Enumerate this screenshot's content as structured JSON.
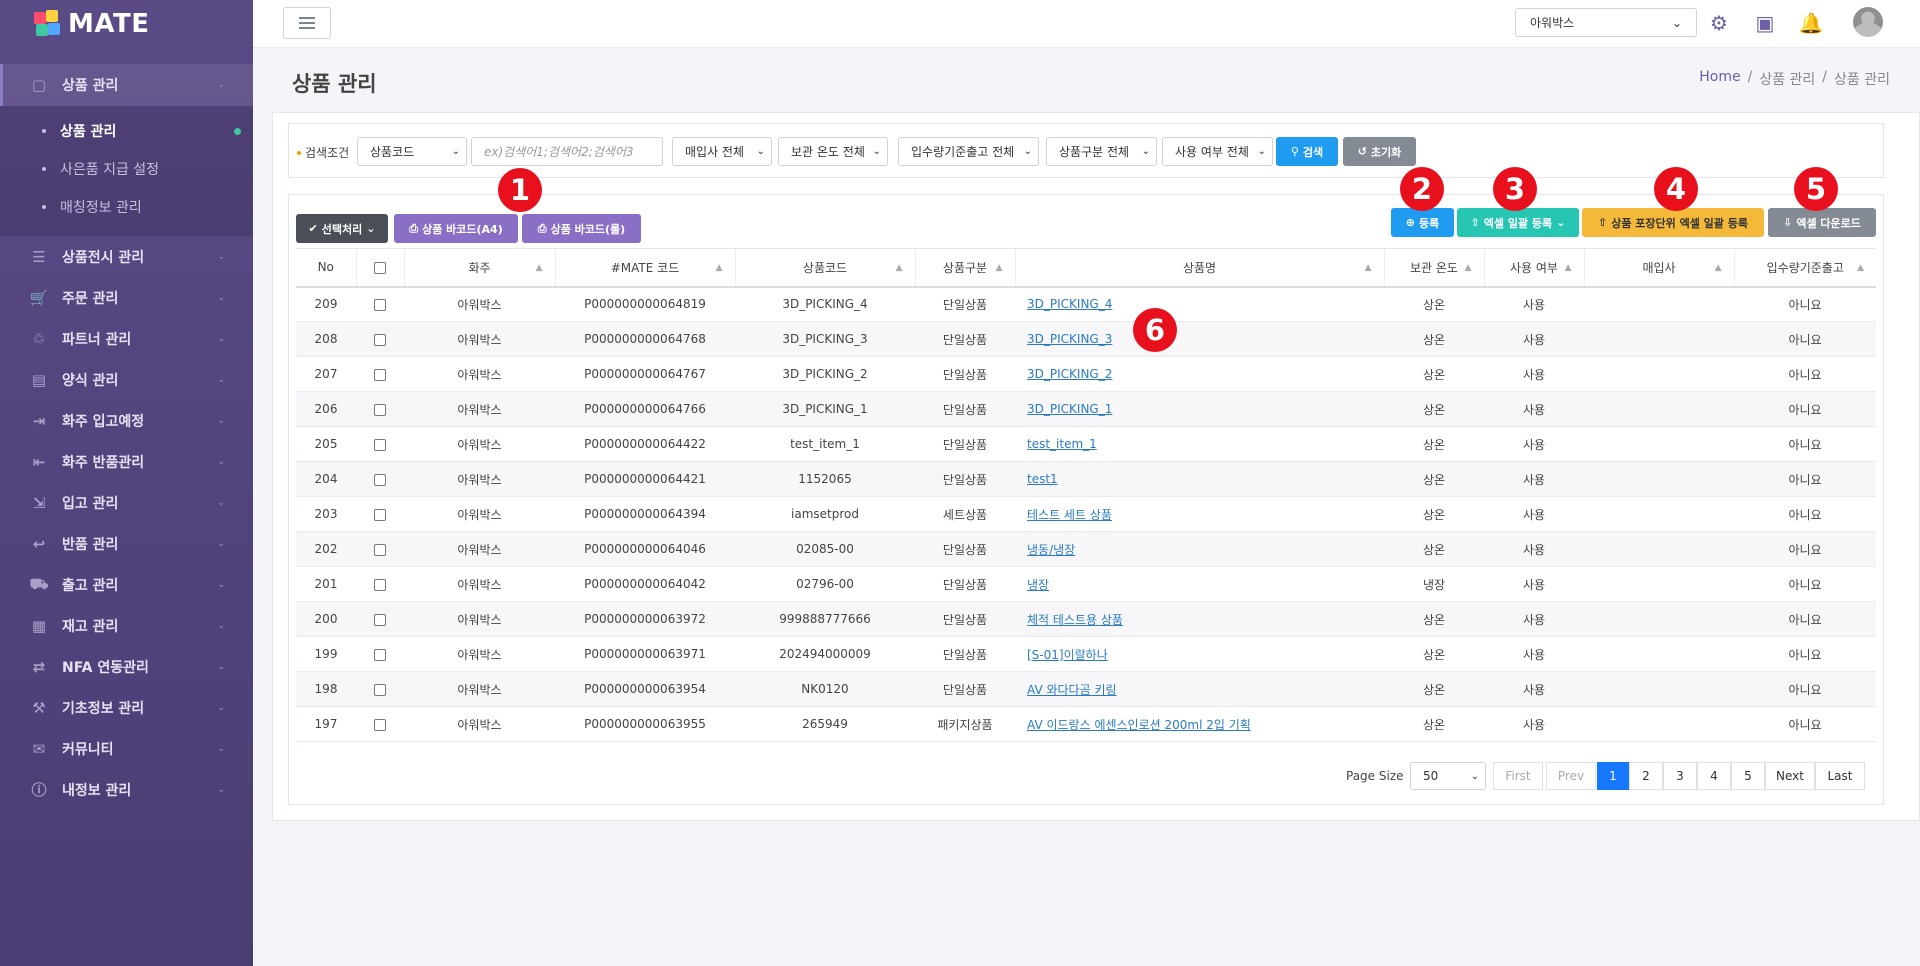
{
  "app": {
    "logo": "MATE"
  },
  "sidebar": {
    "items": [
      {
        "label": "상품 관리",
        "icon": "box-icon",
        "glyph": "▢",
        "active": true
      },
      {
        "label": "상품전시 관리",
        "icon": "display-icon",
        "glyph": "☰"
      },
      {
        "label": "주문 관리",
        "icon": "cart-icon",
        "glyph": "🛒"
      },
      {
        "label": "파트너 관리",
        "icon": "handshake-icon",
        "glyph": "♲"
      },
      {
        "label": "양식 관리",
        "icon": "document-icon",
        "glyph": "▤"
      },
      {
        "label": "화주 입고예정",
        "icon": "truck-in-icon",
        "glyph": "⇥"
      },
      {
        "label": "화주 반품관리",
        "icon": "return-icon",
        "glyph": "⇤"
      },
      {
        "label": "입고 관리",
        "icon": "inbound-icon",
        "glyph": "⇲"
      },
      {
        "label": "반품 관리",
        "icon": "return-box-icon",
        "glyph": "↩"
      },
      {
        "label": "출고 관리",
        "icon": "truck-icon",
        "glyph": "⛟"
      },
      {
        "label": "재고 관리",
        "icon": "stock-icon",
        "glyph": "▦"
      },
      {
        "label": "NFA 연동관리",
        "icon": "link-icon",
        "glyph": "⇄"
      },
      {
        "label": "기초정보 관리",
        "icon": "wrench-icon",
        "glyph": "⚒"
      },
      {
        "label": "커뮤니티",
        "icon": "chat-icon",
        "glyph": "✉"
      },
      {
        "label": "내정보 관리",
        "icon": "info-icon",
        "glyph": "ⓘ"
      }
    ],
    "subitems": [
      {
        "label": "상품 관리",
        "active": true
      },
      {
        "label": "사은품 지급 설정"
      },
      {
        "label": "매칭정보 관리"
      }
    ]
  },
  "topbar": {
    "company": "아워박스"
  },
  "page": {
    "title": "상품 관리"
  },
  "breadcrumb": [
    "Home",
    "/",
    "상품 관리",
    "/",
    "상품 관리"
  ],
  "search": {
    "label": "검색조건",
    "field_select": "상품코드",
    "placeholder": "ex)검색어1;검색어2;검색어3",
    "filters": [
      "매입사 전체",
      "보관 온도 전체",
      "입수량기준출고 전체",
      "상품구분 전체",
      "사용 여부 전체"
    ],
    "search_btn": "검색",
    "reset_btn": "초기화"
  },
  "toolbar": {
    "select_action": "선택처리",
    "barcode_a4": "상품 바코드(A4)",
    "barcode_roll": "상품 바코드(롤)",
    "register": "등록",
    "excel_bulk": "엑셀 일괄 등록",
    "pack_excel_bulk": "상품 포장단위 엑셀 일괄 등록",
    "excel_download": "엑셀 다운로드"
  },
  "colors": {
    "purple_btn": "#8a6fc6",
    "blue_btn": "#1f9bf0",
    "teal_btn": "#26c6b3",
    "yellow_btn": "#f5b93a",
    "gray_btn": "#858b94",
    "dark_btn": "#4a4f57",
    "marker": "#e8101c"
  },
  "table": {
    "headers": [
      "No",
      "",
      "화주",
      "#MATE 코드",
      "상품코드",
      "상품구분",
      "상품명",
      "보관 온도",
      "사용 여부",
      "매입사",
      "입수량기준출고"
    ],
    "rows": [
      [
        "209",
        "아워박스",
        "P000000000064819",
        "3D_PICKING_4",
        "단일상품",
        "3D_PICKING_4",
        "상온",
        "사용",
        "",
        "아니요"
      ],
      [
        "208",
        "아워박스",
        "P000000000064768",
        "3D_PICKING_3",
        "단일상품",
        "3D_PICKING_3",
        "상온",
        "사용",
        "",
        "아니요"
      ],
      [
        "207",
        "아워박스",
        "P000000000064767",
        "3D_PICKING_2",
        "단일상품",
        "3D_PICKING_2",
        "상온",
        "사용",
        "",
        "아니요"
      ],
      [
        "206",
        "아워박스",
        "P000000000064766",
        "3D_PICKING_1",
        "단일상품",
        "3D_PICKING_1",
        "상온",
        "사용",
        "",
        "아니요"
      ],
      [
        "205",
        "아워박스",
        "P000000000064422",
        "test_item_1",
        "단일상품",
        "test_item_1",
        "상온",
        "사용",
        "",
        "아니요"
      ],
      [
        "204",
        "아워박스",
        "P000000000064421",
        "1152065",
        "단일상품",
        "test1",
        "상온",
        "사용",
        "",
        "아니요"
      ],
      [
        "203",
        "아워박스",
        "P000000000064394",
        "iamsetprod",
        "세트상품",
        "테스트 세트 상품",
        "상온",
        "사용",
        "",
        "아니요"
      ],
      [
        "202",
        "아워박스",
        "P000000000064046",
        "02085-00",
        "단일상품",
        "냉동/냉장",
        "상온",
        "사용",
        "",
        "아니요"
      ],
      [
        "201",
        "아워박스",
        "P000000000064042",
        "02796-00",
        "단일상품",
        "냉장",
        "냉장",
        "사용",
        "",
        "아니요"
      ],
      [
        "200",
        "아워박스",
        "P000000000063972",
        "999888777666",
        "단일상품",
        "체적 테스트용 상품",
        "상온",
        "사용",
        "",
        "아니요"
      ],
      [
        "199",
        "아워박스",
        "P000000000063971",
        "202494000009",
        "단일상품",
        "[S-01]이랄하나",
        "상온",
        "사용",
        "",
        "아니요"
      ],
      [
        "198",
        "아워박스",
        "P000000000063954",
        "NK0120",
        "단일상품",
        "AV 와다다곰 키링",
        "상온",
        "사용",
        "",
        "아니요"
      ],
      [
        "197",
        "아워박스",
        "P000000000063955",
        "265949",
        "패키지상품",
        "AV 이드랑스 에센스인로션 200ml 2입 기획",
        "상온",
        "사용",
        "",
        "아니요"
      ]
    ]
  },
  "pagination": {
    "page_size_label": "Page Size",
    "page_size": "50",
    "first": "First",
    "prev": "Prev",
    "pages": [
      "1",
      "2",
      "3",
      "4",
      "5"
    ],
    "current": "1",
    "next": "Next",
    "last": "Last"
  },
  "markers": [
    "1",
    "2",
    "3",
    "4",
    "5",
    "6"
  ]
}
